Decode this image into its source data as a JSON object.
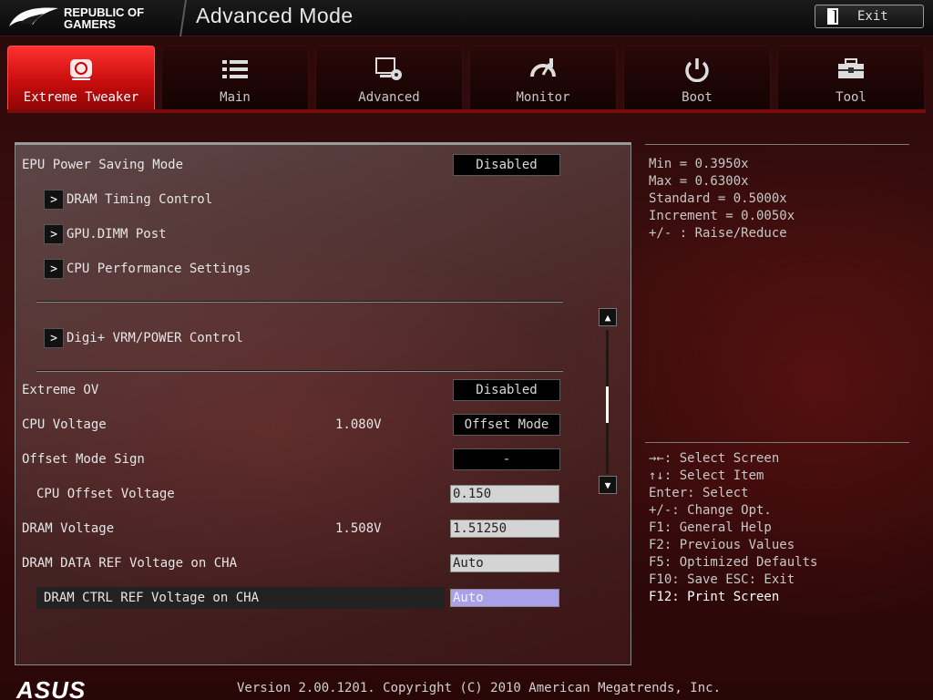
{
  "header": {
    "logo_line1": "REPUBLIC OF",
    "logo_line2": "GAMERS",
    "title": "Advanced Mode",
    "exit_label": "Exit"
  },
  "tabs": [
    {
      "label": "Extreme Tweaker",
      "icon": "tweaker-icon",
      "active": true
    },
    {
      "label": "Main",
      "icon": "list-icon",
      "active": false
    },
    {
      "label": "Advanced",
      "icon": "advanced-settings-icon",
      "active": false
    },
    {
      "label": "Monitor",
      "icon": "gauge-icon",
      "active": false
    },
    {
      "label": "Boot",
      "icon": "power-icon",
      "active": false
    },
    {
      "label": "Tool",
      "icon": "toolbox-icon",
      "active": false
    }
  ],
  "settings": {
    "epu_label": "EPU Power Saving Mode",
    "epu_value": "Disabled",
    "dram_timing": "DRAM Timing Control",
    "gpu_dimm": "GPU.DIMM Post",
    "cpu_perf": "CPU Performance Settings",
    "digi_vrm": "Digi+ VRM/POWER Control",
    "extreme_ov_label": "Extreme OV",
    "extreme_ov_value": "Disabled",
    "cpu_voltage_label": "CPU Voltage",
    "cpu_voltage_reading": "1.080V",
    "cpu_voltage_value": "Offset Mode",
    "offset_sign_label": "Offset Mode Sign",
    "offset_sign_value": "-",
    "cpu_offset_label": "CPU Offset Voltage",
    "cpu_offset_value": "0.150",
    "dram_voltage_label": "DRAM Voltage",
    "dram_voltage_reading": "1.508V",
    "dram_voltage_value": "1.51250",
    "dram_data_ref_label": "DRAM DATA REF Voltage on CHA",
    "dram_data_ref_value": "Auto",
    "dram_ctrl_ref_label": "DRAM CTRL REF Voltage on CHA",
    "dram_ctrl_ref_value": "Auto"
  },
  "info": {
    "min": "Min = 0.3950x",
    "max": "Max = 0.6300x",
    "standard": "Standard = 0.5000x",
    "increment": "Increment = 0.0050x",
    "raise": "+/- : Raise/Reduce"
  },
  "help": {
    "select_screen": "→←: Select Screen",
    "select_item": "↑↓: Select Item",
    "enter": "Enter: Select",
    "change": "+/-: Change Opt.",
    "f1": "F1: General Help",
    "f2": "F2: Previous Values",
    "f5": "F5: Optimized Defaults",
    "f10": "F10: Save  ESC: Exit",
    "f12": "F12: Print Screen"
  },
  "footer": {
    "brand": "ASUS",
    "version": "Version 2.00.1201. Copyright (C) 2010 American Megatrends, Inc."
  },
  "colors": {
    "accent": "#e01818",
    "active_input": "#a8a0e8"
  }
}
